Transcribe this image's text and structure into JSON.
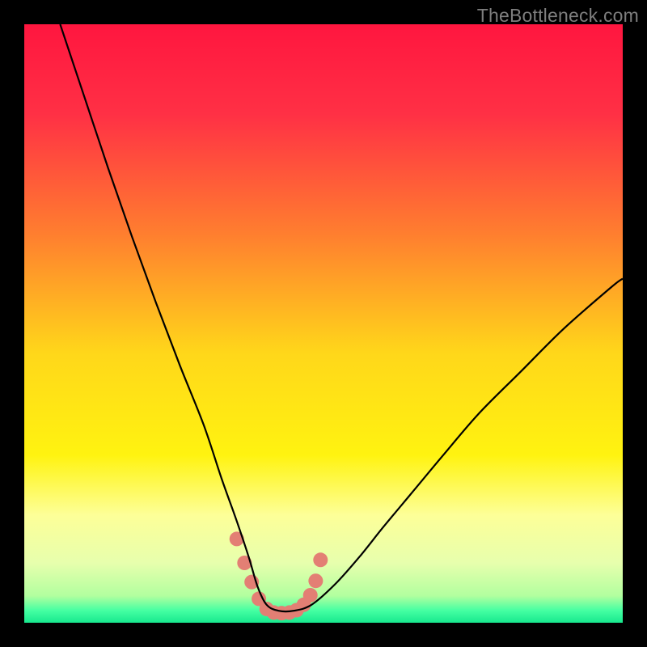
{
  "watermark": "TheBottleneck.com",
  "chart_data": {
    "type": "line",
    "title": "",
    "xlabel": "",
    "ylabel": "",
    "xlim": [
      0,
      100
    ],
    "ylim": [
      0,
      100
    ],
    "gradient_stops": [
      {
        "offset": 0.0,
        "color": "#ff163f"
      },
      {
        "offset": 0.15,
        "color": "#ff3045"
      },
      {
        "offset": 0.35,
        "color": "#ff7e2f"
      },
      {
        "offset": 0.55,
        "color": "#ffd71a"
      },
      {
        "offset": 0.72,
        "color": "#fff310"
      },
      {
        "offset": 0.82,
        "color": "#fdff98"
      },
      {
        "offset": 0.9,
        "color": "#e7ffad"
      },
      {
        "offset": 0.955,
        "color": "#b2ff9f"
      },
      {
        "offset": 0.98,
        "color": "#44ffa2"
      },
      {
        "offset": 1.0,
        "color": "#17e88e"
      }
    ],
    "series": [
      {
        "name": "bottleneck-curve",
        "x": [
          6,
          10,
          14,
          18,
          22,
          26,
          30,
          33,
          35.5,
          37.5,
          39,
          40.5,
          42.5,
          45,
          48,
          52,
          56,
          60,
          65,
          70,
          76,
          83,
          90,
          98,
          100
        ],
        "y": [
          100,
          88,
          76,
          64.5,
          53.5,
          43,
          33,
          24,
          17,
          11,
          6,
          3,
          2,
          2,
          3,
          6.5,
          11,
          16,
          22,
          28,
          35,
          42,
          49,
          56,
          57.5
        ]
      }
    ],
    "marker_points": {
      "comment": "salmon dotted segment near valley floor",
      "x": [
        35.5,
        36.8,
        38.0,
        39.2,
        40.5,
        41.7,
        43.0,
        44.3,
        45.5,
        46.7,
        47.8,
        48.7,
        49.5
      ],
      "y": [
        14.0,
        10.0,
        6.8,
        4.0,
        2.3,
        1.7,
        1.6,
        1.7,
        2.1,
        3.0,
        4.6,
        7.0,
        10.5
      ]
    },
    "style": {
      "curve_color": "#000000",
      "curve_width": 2.2,
      "marker_color": "#e37f74",
      "marker_radius": 9
    }
  }
}
